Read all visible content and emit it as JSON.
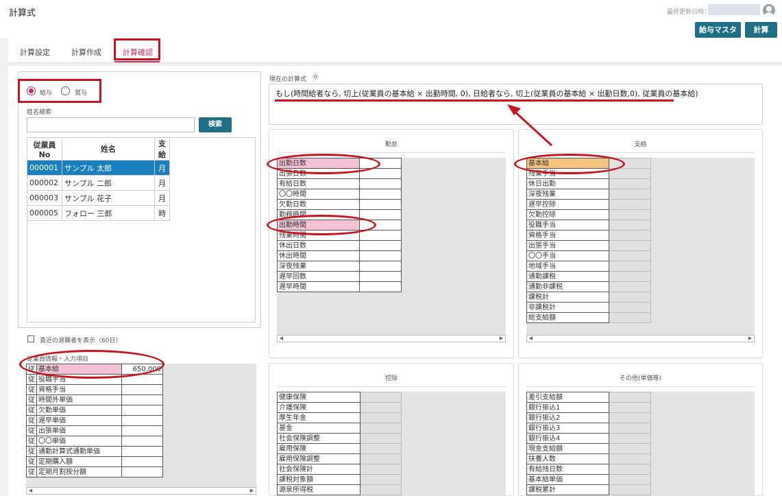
{
  "app": {
    "title": "計算式"
  },
  "header": {
    "last_updated_label": "最終更新日時："
  },
  "buttons": {
    "salary_master": "給与マスタ",
    "calculate": "計算"
  },
  "tabs": [
    {
      "label": "計算設定",
      "active": false
    },
    {
      "label": "計算作成",
      "active": false
    },
    {
      "label": "計算確認",
      "active": true
    }
  ],
  "pay_type": {
    "options": [
      "給与",
      "賞与"
    ],
    "selected": "給与"
  },
  "name_search": {
    "label": "姓名検索",
    "value": "",
    "button": "検索"
  },
  "employee_table": {
    "headers": [
      "従業員No",
      "姓名",
      "支給"
    ],
    "rows": [
      {
        "no": "000001",
        "name": "サンプル 太郎",
        "type": "月",
        "selected": true
      },
      {
        "no": "000002",
        "name": "サンプル 二郎",
        "type": "月",
        "selected": false
      },
      {
        "no": "000003",
        "name": "サンプル 花子",
        "type": "月",
        "selected": false
      },
      {
        "no": "000005",
        "name": "フォロー 三郎",
        "type": "時",
        "selected": false
      }
    ]
  },
  "show_retired": {
    "label": "直近の退職者を表示（60日）",
    "checked": false
  },
  "employee_info": {
    "title": "従業員情報・入力項目",
    "rows": [
      {
        "prefix": "従",
        "label": "基本給",
        "value": "650,000"
      },
      {
        "prefix": "従",
        "label": "役職手当",
        "value": ""
      },
      {
        "prefix": "従",
        "label": "資格手当",
        "value": ""
      },
      {
        "prefix": "従",
        "label": "時間外単価",
        "value": ""
      },
      {
        "prefix": "従",
        "label": "欠勤単価",
        "value": ""
      },
      {
        "prefix": "従",
        "label": "遅早単価",
        "value": ""
      },
      {
        "prefix": "従",
        "label": "出張単価",
        "value": ""
      },
      {
        "prefix": "従",
        "label": "〇〇単価",
        "value": ""
      },
      {
        "prefix": "従",
        "label": "通勤計算式通勤単価",
        "value": ""
      },
      {
        "prefix": "従",
        "label": "定期購入額",
        "value": ""
      },
      {
        "prefix": "従",
        "label": "定期月割按分額",
        "value": ""
      }
    ]
  },
  "formula": {
    "label": "現在の計算式",
    "text": "もし(時間給者なら, 切上(従業員の基本給 × 出勤時間, 0), 日給者なら, 切上(従業員の基本給 × 出勤日数,0), 従業員の基本給)"
  },
  "attendance": {
    "title": "勤怠",
    "items": [
      "出勤日数",
      "出張日数",
      "有給日数",
      "〇〇時間",
      "欠勤日数",
      "勤務時間",
      "出勤時間",
      "残業時間",
      "休出日数",
      "休出時間",
      "深夜残業",
      "遅早回数",
      "遅早時間"
    ],
    "highlighted": [
      "出勤日数",
      "出勤時間"
    ]
  },
  "payment": {
    "title": "支給",
    "items": [
      "基本給",
      "残業手当",
      "休日出勤",
      "深夜残業",
      "遅早控除",
      "欠勤控除",
      "役職手当",
      "資格手当",
      "出張手当",
      "〇〇手当",
      "地域手当",
      "通勤課税",
      "通勤非課税",
      "課税計",
      "非課税計",
      "総支給額"
    ],
    "highlighted": [
      "基本給"
    ]
  },
  "deduction": {
    "title": "控除",
    "items": [
      "健康保険",
      "介護保険",
      "厚生年金",
      "基金",
      "社会保険調整",
      "雇用保険",
      "雇用保険調整",
      "社会保険計",
      "課税対象額",
      "源泉所得税"
    ]
  },
  "other": {
    "title": "その他(単価等)",
    "items": [
      "差引支給額",
      "銀行振込1",
      "銀行振込2",
      "銀行振込3",
      "銀行振込4",
      "現金支給額",
      "扶養人数",
      "有給残日数",
      "基本給単価",
      "課税累計"
    ]
  },
  "colors": {
    "accent": "#c03060",
    "button": "#1f6f87",
    "selected_row": "#1a7fbd",
    "highlight_pink": "#f4c2d4",
    "highlight_orange": "#f7c47e",
    "annotation_red": "#c8141e"
  },
  "icons": {
    "formula_hint": "lightbulb-icon",
    "user": "avatar-icon"
  }
}
